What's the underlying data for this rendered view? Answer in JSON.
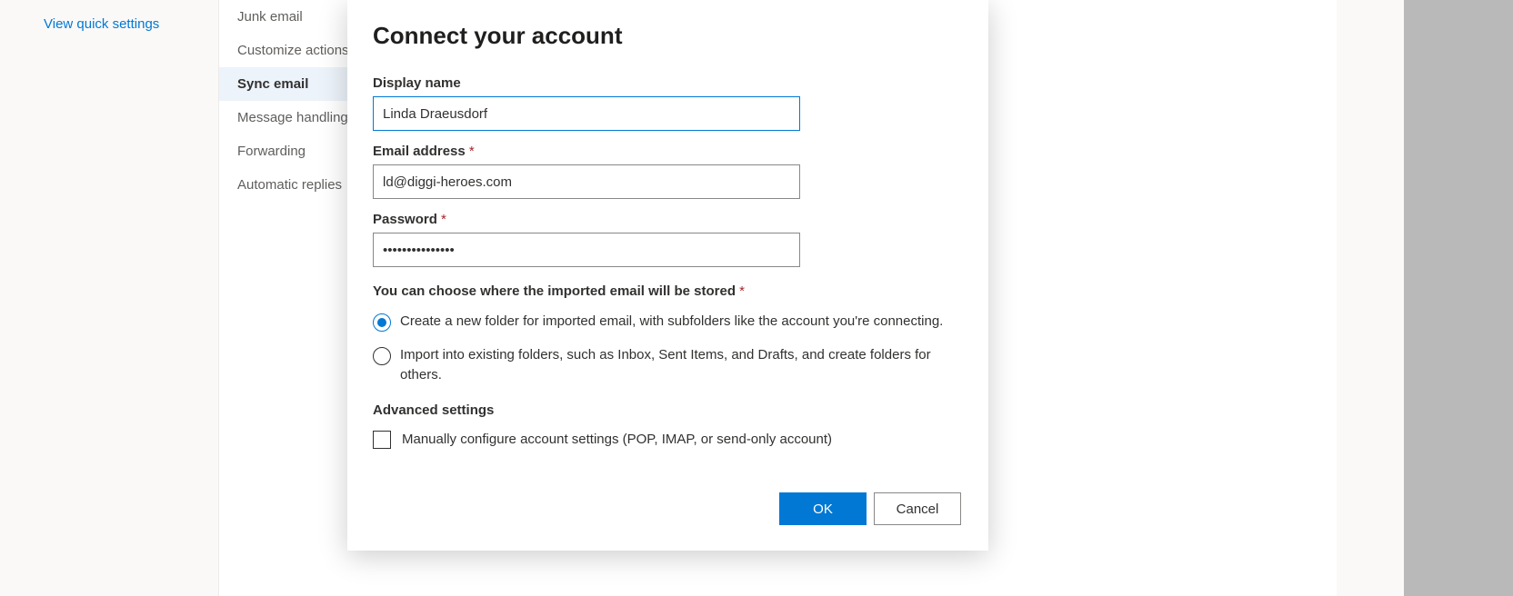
{
  "quick_settings_link": "View quick settings",
  "sidebar": {
    "items": [
      {
        "label": "Junk email",
        "selected": false
      },
      {
        "label": "Customize actions",
        "selected": false
      },
      {
        "label": "Sync email",
        "selected": true
      },
      {
        "label": "Message handling",
        "selected": false
      },
      {
        "label": "Forwarding",
        "selected": false
      },
      {
        "label": "Automatic replies",
        "selected": false
      }
    ]
  },
  "dialog": {
    "title": "Connect your account",
    "display_name_label": "Display name",
    "display_name_value": "Linda Draeusdorf",
    "email_label": "Email address",
    "email_value": "ld@diggi-heroes.com",
    "password_label": "Password",
    "password_value": "•••••••••••••••",
    "store_label": "You can choose where the imported email will be stored",
    "radio_options": [
      {
        "label": "Create a new folder for imported email, with subfolders like the account you're connecting.",
        "checked": true
      },
      {
        "label": "Import into existing folders, such as Inbox, Sent Items, and Drafts, and create folders for others.",
        "checked": false
      }
    ],
    "advanced_label": "Advanced settings",
    "manual_checkbox_label": "Manually configure account settings (POP, IMAP, or send-only account)",
    "ok_label": "OK",
    "cancel_label": "Cancel"
  }
}
